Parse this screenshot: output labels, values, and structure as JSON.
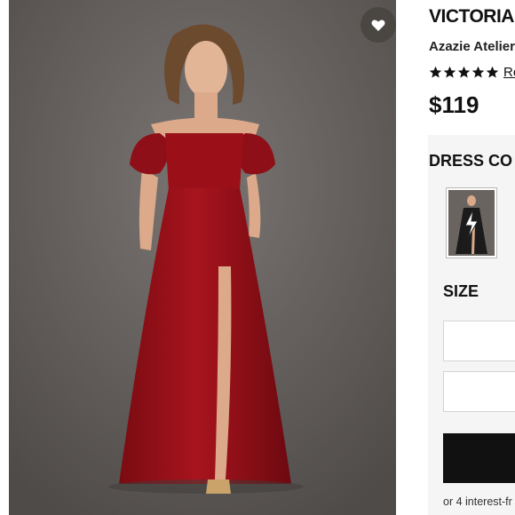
{
  "product": {
    "title": "VICTORIA",
    "brand": "Azazie Atelier",
    "rating_stars": 5,
    "reviews_label": "Re",
    "price": "$119"
  },
  "options": {
    "color_heading": "DRESS CO",
    "size_heading": "SIZE",
    "payment_note": "or 4 interest-fr"
  },
  "colors": {
    "dress": "#9b1018",
    "background": "#666260",
    "panel": "#f5f5f5",
    "button": "#111111"
  },
  "icons": {
    "favorite": "heart-icon",
    "rating": "star-icon",
    "swatch_overlay": "lightning-icon"
  }
}
